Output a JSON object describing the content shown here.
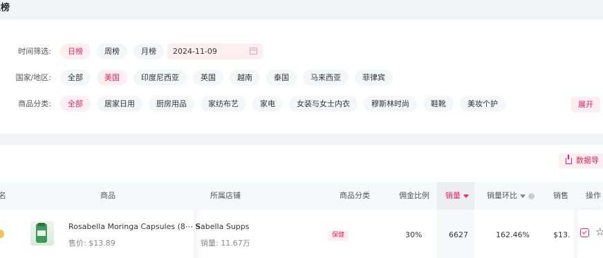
{
  "page": {
    "title": "量榜"
  },
  "filters": {
    "time": {
      "label": "时间筛选:",
      "options": [
        "日榜",
        "周榜",
        "月榜"
      ],
      "selected": "日榜",
      "date_value": "2024-11-09"
    },
    "region": {
      "label": "国家/地区:",
      "options": [
        "全部",
        "美国",
        "印度尼西亚",
        "英国",
        "越南",
        "泰国",
        "马来西亚",
        "菲律宾"
      ],
      "selected": "美国"
    },
    "category": {
      "label": "商品分类:",
      "options": [
        "全部",
        "居家日用",
        "厨房用品",
        "家纺布艺",
        "家电",
        "女装与女士内衣",
        "穆斯林时尚",
        "鞋靴",
        "美妆个护"
      ],
      "selected": "全部",
      "expand_label": "展开"
    }
  },
  "toolbar": {
    "export_label": "数据导"
  },
  "table": {
    "columns": {
      "rank": "名",
      "product": "商品",
      "shop": "所属店铺",
      "category": "商品分类",
      "commission": "佣金比例",
      "sales": "销量",
      "sales_ratio": "销量环比",
      "revenue": "销售",
      "ops": "操作"
    },
    "rows": [
      {
        "product_name": "Rosabella Moringa Capsules (8⋯",
        "product_price": "售价: $13.89",
        "shop_name": "abella Supps",
        "shop_sales": "销量: 11.67万",
        "category": "保健",
        "commission": "30%",
        "sales": "6627",
        "sales_ratio": "162.46%",
        "revenue": "$13."
      }
    ]
  },
  "colors": {
    "accent": "#f0245c",
    "accent_bg": "#fdeef1",
    "page_bg": "#f2f3f5"
  }
}
